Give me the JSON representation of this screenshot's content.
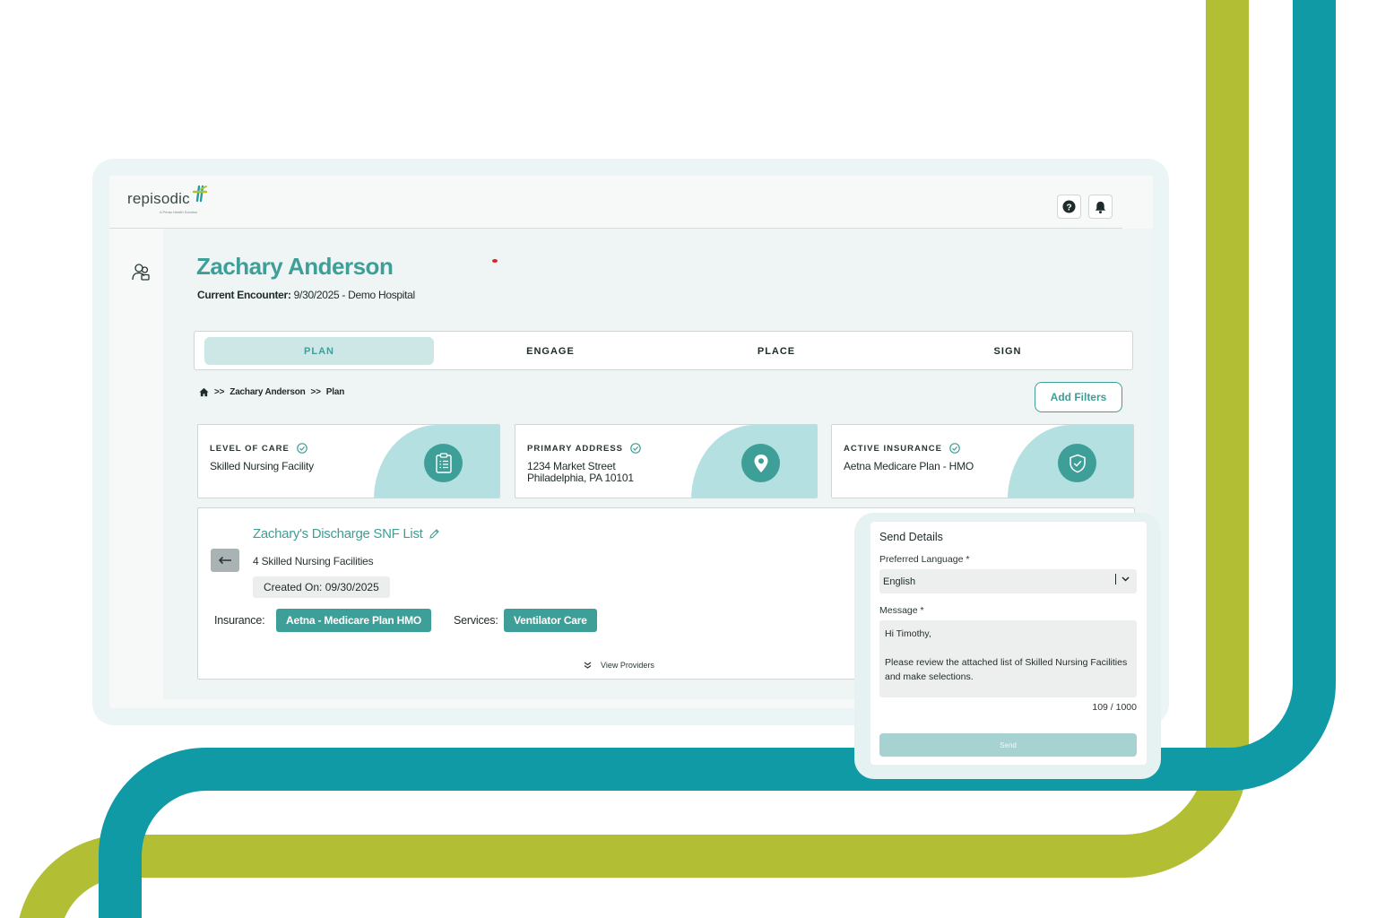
{
  "brand": {
    "name": "repisodic",
    "tagline": "A Peraz Health Solution"
  },
  "patient": {
    "name": "Zachary Anderson",
    "encounter_label": "Current Encounter:",
    "encounter_value": "9/30/2025 - Demo Hospital"
  },
  "tabs": [
    {
      "label": "PLAN",
      "active": true
    },
    {
      "label": "ENGAGE",
      "active": false
    },
    {
      "label": "PLACE",
      "active": false
    },
    {
      "label": "SIGN",
      "active": false
    }
  ],
  "breadcrumb": {
    "sep1": ">>",
    "patient": "Zachary Anderson",
    "sep2": ">>",
    "page": "Plan"
  },
  "add_filters_label": "Add Filters",
  "cards": [
    {
      "label": "LEVEL OF CARE",
      "value": "Skilled Nursing Facility",
      "icon": "clipboard-icon"
    },
    {
      "label": "PRIMARY ADDRESS",
      "value": "1234 Market Street\nPhiladelphia, PA 10101",
      "icon": "map-pin-icon"
    },
    {
      "label": "ACTIVE INSURANCE",
      "value": "Aetna Medicare Plan - HMO",
      "icon": "shield-icon"
    }
  ],
  "list": {
    "title": "Zachary's Discharge SNF List",
    "subtitle": "4 Skilled Nursing Facilities",
    "created": "Created On:  09/30/2025",
    "insurance_label": "Insurance:",
    "insurance_value": "Aetna - Medicare Plan HMO",
    "services_label": "Services:",
    "services_value": "Ventilator Care",
    "view_providers": "View Providers"
  },
  "send_details": {
    "title": "Send Details",
    "language_label": "Preferred Language *",
    "language_value": "English",
    "message_label": "Message *",
    "message_value": "Hi Timothy,\n\nPlease review the attached list of Skilled Nursing Facilities and make selections.",
    "counter": "109 / 1000",
    "send_label": "Send"
  },
  "colors": {
    "primary": "#3e9e98",
    "pipe_teal": "#0f9aa6",
    "pipe_green": "#b2be34",
    "card_blob": "#b5e0e2",
    "tab_active_bg": "#cde7e7"
  }
}
